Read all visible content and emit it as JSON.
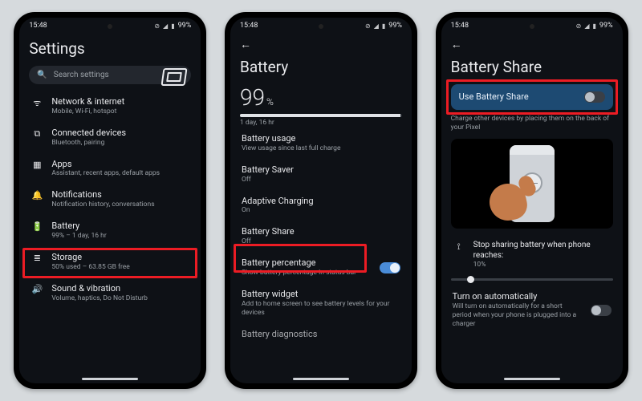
{
  "status": {
    "time": "15:48",
    "battery": "99%"
  },
  "screen1": {
    "title": "Settings",
    "search_placeholder": "Search settings",
    "items": [
      {
        "icon": "wifi",
        "label": "Network & internet",
        "sub": "Mobile, Wi-Fi, hotspot"
      },
      {
        "icon": "devices",
        "label": "Connected devices",
        "sub": "Bluetooth, pairing"
      },
      {
        "icon": "apps",
        "label": "Apps",
        "sub": "Assistant, recent apps, default apps"
      },
      {
        "icon": "bell",
        "label": "Notifications",
        "sub": "Notification history, conversations"
      },
      {
        "icon": "battery",
        "label": "Battery",
        "sub": "99% – 1 day, 16 hr"
      },
      {
        "icon": "storage",
        "label": "Storage",
        "sub": "50% used – 63.85 GB free"
      },
      {
        "icon": "sound",
        "label": "Sound & vibration",
        "sub": "Volume, haptics, Do Not Disturb"
      }
    ]
  },
  "screen2": {
    "title": "Battery",
    "percent": "99",
    "percent_suffix": "%",
    "estimate": "1 day, 16 hr",
    "items": [
      {
        "label": "Battery usage",
        "sub": "View usage since last full charge"
      },
      {
        "label": "Battery Saver",
        "sub": "Off"
      },
      {
        "label": "Adaptive Charging",
        "sub": "On"
      },
      {
        "label": "Battery Share",
        "sub": "Off"
      },
      {
        "label": "Battery percentage",
        "sub": "Show battery percentage in status bar",
        "toggle": true,
        "on": true
      },
      {
        "label": "Battery widget",
        "sub": "Add to home screen to see battery levels for your devices"
      },
      {
        "label": "Battery diagnostics",
        "sub": ""
      }
    ]
  },
  "screen3": {
    "title": "Battery Share",
    "use_label": "Use Battery Share",
    "use_on": false,
    "desc": "Charge other devices by placing them on the back of your Pixel",
    "stop": {
      "icon": "tune",
      "label": "Stop sharing battery when phone reaches:",
      "value": "10%"
    },
    "auto": {
      "label": "Turn on automatically",
      "sub": "Will turn on automatically for a short period when your phone is plugged into a charger",
      "on": false
    }
  }
}
